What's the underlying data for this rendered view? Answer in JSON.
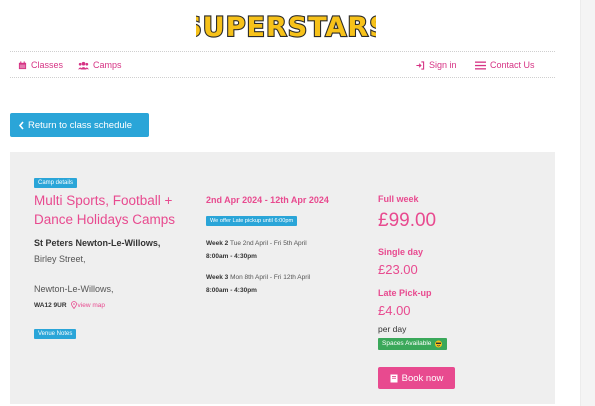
{
  "brand": {
    "logo_text": "SUPERSTARS"
  },
  "nav": {
    "classes": "Classes",
    "camps": "Camps",
    "sign_in": "Sign in",
    "contact": "Contact Us"
  },
  "back_button": "Return to class schedule",
  "camp": {
    "details_badge": "Camp details",
    "title_line1": "Multi Sports, Football +",
    "title_line2": "Dance Holidays Camps",
    "venue_name": "St Peters Newton-Le-Willows,",
    "street": "Birley Street,",
    "town": "Newton-Le-Willows,",
    "postcode": "WA12 9UR",
    "view_map": "view map",
    "venue_notes": "Venue Notes",
    "dates": "2nd Apr 2024 - 12th Apr 2024",
    "late_pickup_badge": "We offer Late pickup until 6:00pm",
    "weeks": [
      {
        "label": "Week 2",
        "range": "Tue 2nd April - Fri 5th April",
        "time": "8:00am - 4:30pm"
      },
      {
        "label": "Week 3",
        "range": "Mon 8th April - Fri 12th April",
        "time": "8:00am - 4:30pm"
      }
    ],
    "pricing": {
      "full_week_label": "Full week",
      "full_week_price": "£99.00",
      "single_day_label": "Single day",
      "single_day_price": "£23.00",
      "late_label": "Late Pick-up",
      "late_price": "£4.00",
      "per_day": "per day"
    },
    "spaces_badge": "Spaces Available",
    "book_button": "Book now"
  },
  "colors": {
    "pink": "#e84a8f",
    "blue": "#2aa5d8",
    "green": "#3aa85a",
    "logo_yellow": "#f7c21a"
  },
  "icons": [
    "calendar-icon",
    "users-icon",
    "sign-in-icon",
    "menu-icon",
    "chevron-left-icon",
    "map-pin-icon",
    "emoji-icon",
    "book-icon"
  ]
}
